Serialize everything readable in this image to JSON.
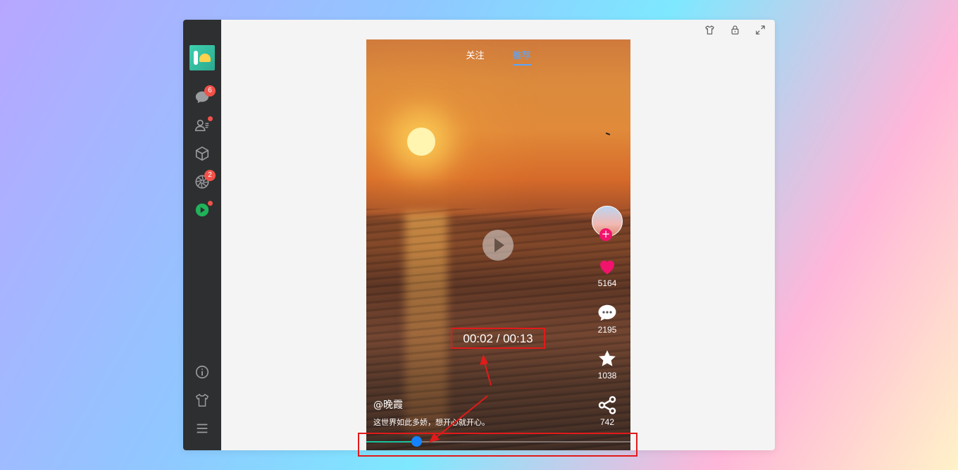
{
  "sidebar": {
    "items": [
      {
        "name": "chat",
        "icon": "chat-bubble-icon",
        "badge": "6"
      },
      {
        "name": "contacts",
        "icon": "contacts-icon",
        "dot": true
      },
      {
        "name": "box",
        "icon": "cube-icon"
      },
      {
        "name": "moments",
        "icon": "aperture-icon",
        "badge": "2"
      },
      {
        "name": "video",
        "icon": "play-circle-icon",
        "dot": true
      }
    ],
    "bottom_items": [
      {
        "name": "info",
        "icon": "info-icon"
      },
      {
        "name": "skin",
        "icon": "shirt-icon"
      },
      {
        "name": "menu",
        "icon": "menu-icon"
      }
    ]
  },
  "window_actions": [
    "shirt-icon",
    "lock-icon",
    "expand-icon"
  ],
  "video": {
    "tabs": [
      {
        "label": "关注",
        "active": false
      },
      {
        "label": "推荐",
        "active": true
      }
    ],
    "time_display": "00:02 / 00:13",
    "progress": 0.19,
    "author": "@晚霞",
    "description": "这世界如此多娇，想开心就开心。",
    "likes": "5164",
    "comments": "2195",
    "favorites": "1038",
    "shares": "742"
  },
  "colors": {
    "sidebar_bg": "#2e2f31",
    "badge": "#f0524a",
    "like": "#f2136d",
    "active_tab": "#58a6ff",
    "progress_fill": "#19c2a0",
    "progress_thumb": "#1583ff",
    "annotation": "#e11a1a"
  }
}
